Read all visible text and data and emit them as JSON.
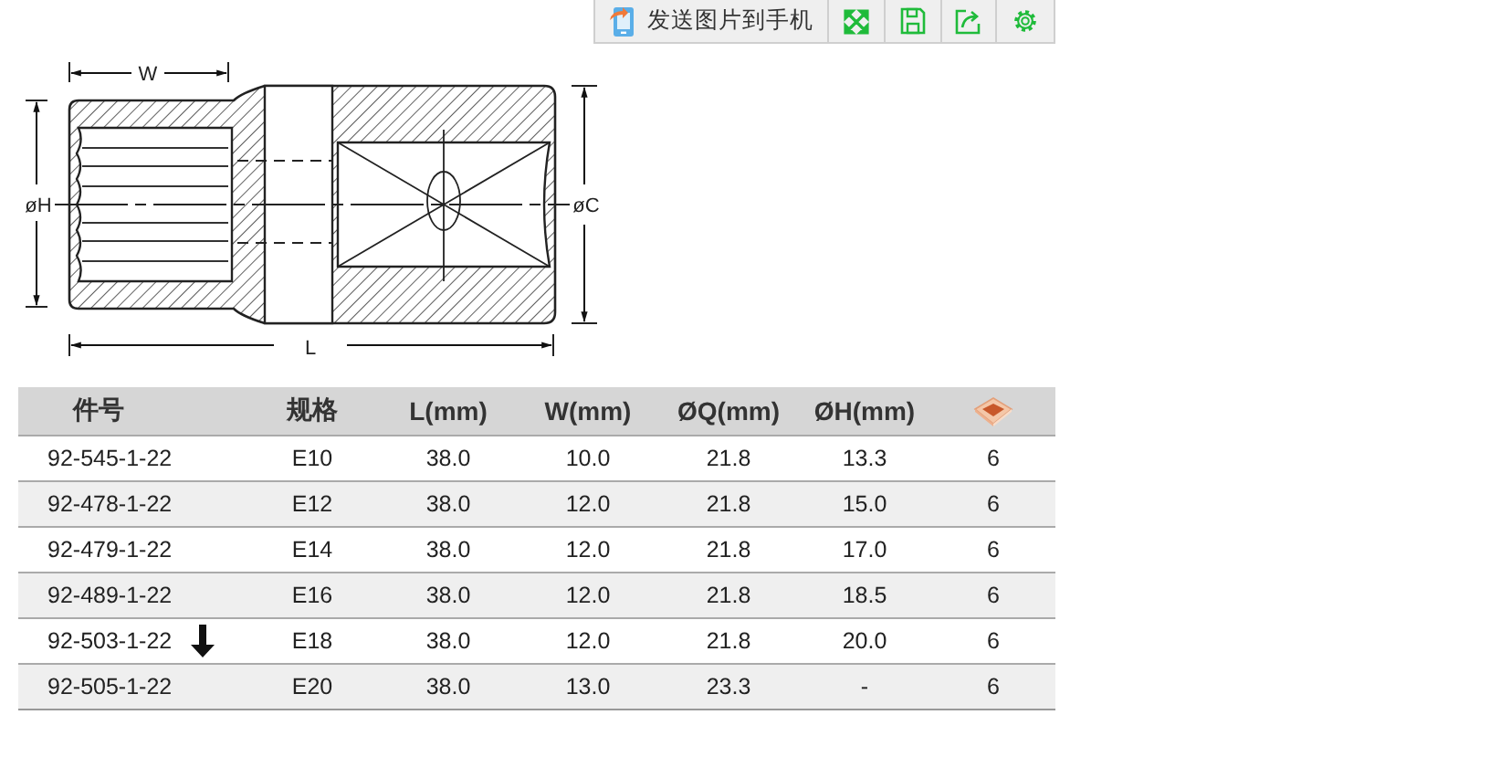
{
  "toolbar": {
    "send_button": "发送图片到手机"
  },
  "diagram": {
    "labels": {
      "w": "W",
      "l": "L",
      "h": "øH",
      "c": "øC"
    }
  },
  "table": {
    "columns": [
      "件号",
      "规格",
      "L(mm)",
      "W(mm)",
      "ØQ(mm)",
      "ØH(mm)"
    ],
    "rows": [
      {
        "cells": [
          "92-545-1-22",
          "E10",
          "38.0",
          "10.0",
          "21.8",
          "13.3",
          "6"
        ],
        "arrow": false
      },
      {
        "cells": [
          "92-478-1-22",
          "E12",
          "38.0",
          "12.0",
          "21.8",
          "15.0",
          "6"
        ],
        "arrow": false
      },
      {
        "cells": [
          "92-479-1-22",
          "E14",
          "38.0",
          "12.0",
          "21.8",
          "17.0",
          "6"
        ],
        "arrow": false
      },
      {
        "cells": [
          "92-489-1-22",
          "E16",
          "38.0",
          "12.0",
          "21.8",
          "18.5",
          "6"
        ],
        "arrow": false
      },
      {
        "cells": [
          "92-503-1-22",
          "E18",
          "38.0",
          "12.0",
          "21.8",
          "20.0",
          "6"
        ],
        "arrow": true
      },
      {
        "cells": [
          "92-505-1-22",
          "E20",
          "38.0",
          "13.0",
          "23.3",
          "-",
          "6"
        ],
        "arrow": false
      }
    ]
  }
}
